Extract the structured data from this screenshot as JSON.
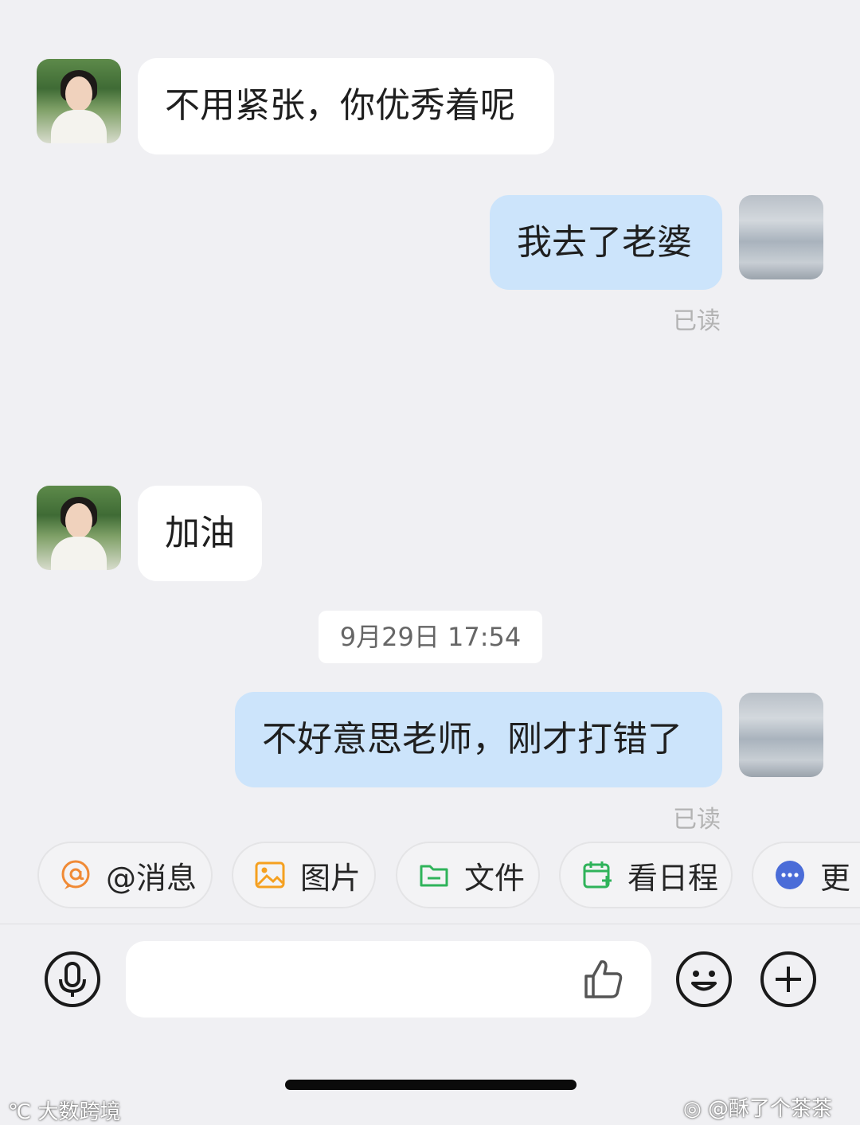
{
  "messages": [
    {
      "side": "in",
      "text": "不用紧张，你优秀着呢"
    },
    {
      "side": "out",
      "text": "我去了老婆",
      "status": "已读"
    },
    {
      "side": "in",
      "text": "加油"
    },
    {
      "side": "out",
      "text": "不好意思老师，刚才打错了",
      "status": "已读"
    }
  ],
  "timestamp": "9月29日 17:54",
  "quick_actions": [
    {
      "label": "@消息",
      "icon": "at-icon",
      "color": "#f08a35"
    },
    {
      "label": "图片",
      "icon": "image-icon",
      "color": "#f5a020"
    },
    {
      "label": "文件",
      "icon": "folder-icon",
      "color": "#2fb35a"
    },
    {
      "label": "看日程",
      "icon": "calendar-icon",
      "color": "#2fb35a"
    },
    {
      "label": "更",
      "icon": "more-icon",
      "color": "#4a6cd8"
    }
  ],
  "input": {
    "placeholder": ""
  },
  "watermarks": {
    "left": "大数跨境",
    "right": "@酥了个茶茶"
  },
  "colors": {
    "background": "#f0f0f3",
    "bubble_out": "#cce4fb",
    "bubble_in": "#ffffff"
  }
}
